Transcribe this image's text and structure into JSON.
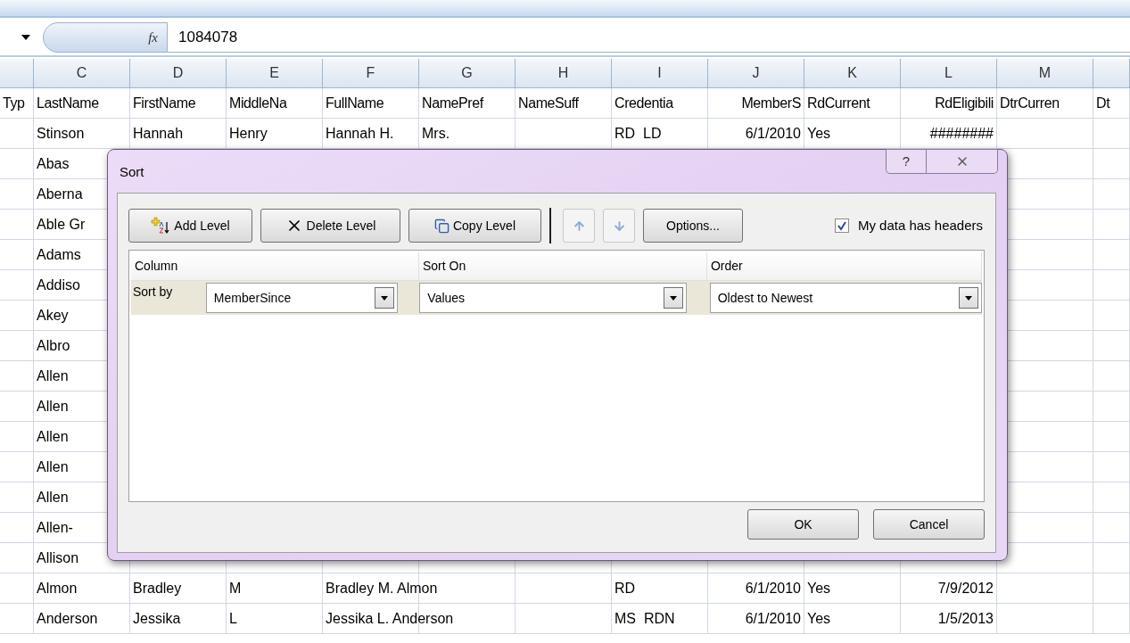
{
  "formula_bar": {
    "function_label": "fx",
    "value": "1084078"
  },
  "columns": [
    "C",
    "D",
    "E",
    "F",
    "G",
    "H",
    "I",
    "J",
    "K",
    "L",
    "M"
  ],
  "rows": [
    {
      "B": "Typ",
      "C": "LastName",
      "D": "FirstName",
      "E": "MiddleNa",
      "F": "FullName",
      "G": "NamePref",
      "H": "NameSuff",
      "I": "Credentia",
      "J": "MemberS",
      "K": "RdCurrent",
      "L": "RdEligibili",
      "M": "DtrCurren",
      "N": "Dt"
    },
    {
      "C": "Stinson",
      "D": "Hannah",
      "E": "Henry",
      "F": "Hannah H.",
      "G": "Mrs.",
      "I": "RD  LD",
      "J": "6/1/2010",
      "K": "Yes",
      "L": "########"
    },
    {
      "C": "Abas"
    },
    {
      "C": "Aberna"
    },
    {
      "C": "Able Gr"
    },
    {
      "C": "Adams"
    },
    {
      "C": "Addiso"
    },
    {
      "C": "Akey"
    },
    {
      "C": "Albro"
    },
    {
      "C": "Allen"
    },
    {
      "C": "Allen"
    },
    {
      "C": "Allen"
    },
    {
      "C": "Allen"
    },
    {
      "C": "Allen"
    },
    {
      "C": "Allen-"
    },
    {
      "C": "Allison"
    },
    {
      "C": "Almon",
      "D": "Bradley",
      "E": "M",
      "F": "Bradley M. Almon",
      "I": "RD",
      "J": "6/1/2010",
      "K": "Yes",
      "L": "7/9/2012"
    },
    {
      "C": "Anderson",
      "D": "Jessika",
      "E": "L",
      "F": "Jessika L. Anderson",
      "I": "MS  RDN",
      "J": "6/1/2010",
      "K": "Yes",
      "L": "1/5/2013"
    }
  ],
  "dialog": {
    "title": "Sort",
    "help": "?",
    "toolbar": [
      {
        "kind": "add",
        "label": "Add Level",
        "disabled": false
      },
      {
        "kind": "delete",
        "label": "Delete Level",
        "disabled": false
      },
      {
        "kind": "copy",
        "label": "Copy Level",
        "disabled": false
      },
      {
        "kind": "up",
        "disabled": true
      },
      {
        "kind": "down",
        "disabled": true
      },
      {
        "kind": "options",
        "label": "Options...",
        "disabled": false
      }
    ],
    "headers_checkbox": {
      "label": "My data has headers",
      "checked": true
    },
    "list_headers": [
      "Column",
      "Sort On",
      "Order"
    ],
    "levels": [
      {
        "label": "Sort by",
        "selected": true,
        "column": "MemberSince",
        "sort_on": "Values",
        "order": "Oldest to Newest"
      }
    ],
    "buttons": [
      "OK",
      "Cancel"
    ]
  }
}
